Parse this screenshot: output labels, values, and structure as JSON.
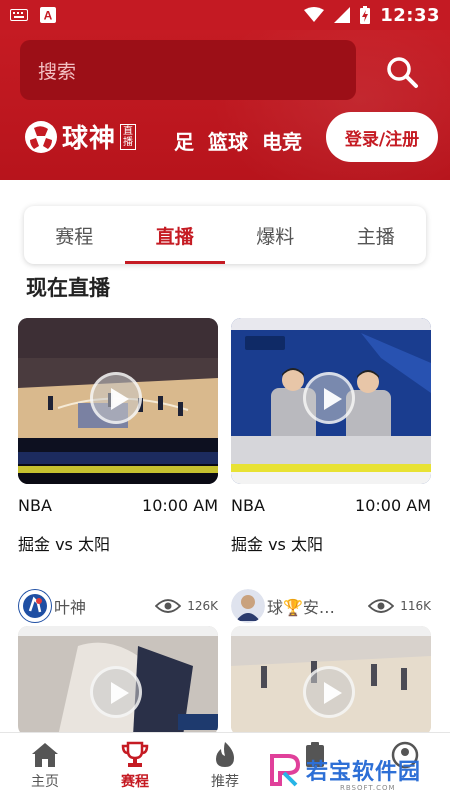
{
  "status_bar": {
    "time": "12:33"
  },
  "header": {
    "search_placeholder": "搜索",
    "logo_text": "球神",
    "logo_badge": "直播",
    "nav_items": [
      "足",
      "篮球",
      "电竞"
    ],
    "login_label": "登录/注册"
  },
  "tabs": [
    {
      "label": "赛程",
      "active": false
    },
    {
      "label": "直播",
      "active": true
    },
    {
      "label": "爆料",
      "active": false
    },
    {
      "label": "主播",
      "active": false
    }
  ],
  "section_title": "现在直播",
  "cards": [
    {
      "league": "NBA",
      "time": "10:00 AM",
      "teams": "掘金 vs 太阳",
      "anchor": "叶神",
      "views": "126K"
    },
    {
      "league": "NBA",
      "time": "10:00 AM",
      "teams": "掘金 vs 太阳",
      "anchor": "球🏆安…",
      "views": "116K"
    }
  ],
  "bottom_nav": [
    {
      "label": "主页",
      "icon": "home-icon",
      "active": false
    },
    {
      "label": "赛程",
      "icon": "trophy-icon",
      "active": true
    },
    {
      "label": "推荐",
      "icon": "flame-icon",
      "active": false
    },
    {
      "label": "",
      "icon": "clipboard-icon",
      "active": false
    },
    {
      "label": "",
      "icon": "profile-icon",
      "active": false
    }
  ],
  "watermark": {
    "text": "若宝软件园",
    "sub": "RBSOFT.COM"
  },
  "colors": {
    "brand": "#c51b23",
    "watermark": "#2d6fd6"
  }
}
